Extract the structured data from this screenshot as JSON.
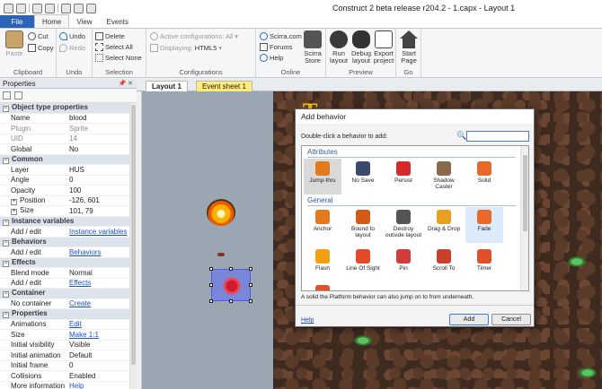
{
  "window": {
    "title": "Construct 2 beta release r204.2 - 1.capx - Layout 1"
  },
  "ribbon_tabs": [
    "File",
    "Home",
    "View",
    "Events"
  ],
  "ribbon": {
    "clipboard": {
      "paste": "Paste",
      "cut": "Cut",
      "copy": "Copy",
      "label": "Clipboard"
    },
    "undo": {
      "undo": "Undo",
      "redo": "Redo",
      "label": "Undo"
    },
    "selection": {
      "delete": "Delete",
      "select_all": "Select All",
      "select_none": "Select None",
      "label": "Selection"
    },
    "configurations": {
      "active": "Active configurations: All",
      "displaying": "Displaying:",
      "displaying_value": "HTML5",
      "label": "Configurations"
    },
    "online": {
      "scirra": "Scirra.com",
      "forums": "Forums",
      "help": "Help",
      "store": "Scirra Store",
      "label": "Online"
    },
    "preview": {
      "run": "Run layout",
      "debug": "Debug layout",
      "export": "Export project",
      "label": "Preview"
    },
    "go": {
      "start": "Start Page",
      "label": "Go"
    }
  },
  "properties_panel": {
    "title": "Properties",
    "rows": [
      {
        "type": "cat",
        "k": "Object type properties"
      },
      {
        "k": "Name",
        "v": "blood"
      },
      {
        "k": "Plugin",
        "v": "Sprite",
        "dim": true
      },
      {
        "k": "UID",
        "v": "14",
        "dim": true
      },
      {
        "k": "Global",
        "v": "No"
      },
      {
        "type": "cat",
        "k": "Common"
      },
      {
        "k": "Layer",
        "v": "HUS"
      },
      {
        "k": "Angle",
        "v": "0"
      },
      {
        "k": "Opacity",
        "v": "100"
      },
      {
        "k": "Position",
        "v": "-126, 601",
        "plus": true
      },
      {
        "k": "Size",
        "v": "101, 79",
        "plus": true
      },
      {
        "type": "cat",
        "k": "Instance variables"
      },
      {
        "k": "Add / edit",
        "v": "Instance variables",
        "link": true
      },
      {
        "type": "cat",
        "k": "Behaviors"
      },
      {
        "k": "Add / edit",
        "v": "Behaviors",
        "link": true
      },
      {
        "type": "cat",
        "k": "Effects"
      },
      {
        "k": "Blend mode",
        "v": "Normal"
      },
      {
        "k": "Add / edit",
        "v": "Effects",
        "link": true
      },
      {
        "type": "cat",
        "k": "Container"
      },
      {
        "k": "No container",
        "v": "Create",
        "link": true
      },
      {
        "type": "cat",
        "k": "Properties"
      },
      {
        "k": "Animations",
        "v": "Edit",
        "link": true
      },
      {
        "k": "Size",
        "v": "Make 1:1",
        "link": true
      },
      {
        "k": "Initial visibility",
        "v": "Visible"
      },
      {
        "k": "Initial animation",
        "v": "Default"
      },
      {
        "k": "Initial frame",
        "v": "0"
      },
      {
        "k": "Collisions",
        "v": "Enabled"
      },
      {
        "k": "More information",
        "v": "Help",
        "link": true
      }
    ]
  },
  "doc_tabs": {
    "layout": "Layout 1",
    "events": "Event sheet 1"
  },
  "canvas": {
    "gold_text": "T"
  },
  "dialog": {
    "title": "Add behavior",
    "prompt": "Double-click a behavior to add:",
    "search_value": "",
    "categories": [
      {
        "name": "Attributes",
        "items": [
          {
            "label": "Jump-thru",
            "icon": "jumpthru-icon",
            "color": "#e07a1c",
            "selected": true
          },
          {
            "label": "No Save",
            "icon": "nosave-icon",
            "color": "#3b4a6b"
          },
          {
            "label": "Persist",
            "icon": "persist-icon",
            "color": "#d62a2a"
          },
          {
            "label": "Shadow Caster",
            "icon": "shadow-caster-icon",
            "color": "#8a6a4a"
          },
          {
            "label": "Solid",
            "icon": "solid-icon",
            "color": "#e8672a"
          }
        ]
      },
      {
        "name": "General",
        "items": [
          {
            "label": "Anchor",
            "icon": "anchor-icon",
            "color": "#e07a1c"
          },
          {
            "label": "Bound to layout",
            "icon": "bound-icon",
            "color": "#d45a1a"
          },
          {
            "label": "Destroy outside layout",
            "icon": "destroy-icon",
            "color": "#555555"
          },
          {
            "label": "Drag & Drop",
            "icon": "drag-drop-icon",
            "color": "#e8a020"
          },
          {
            "label": "Fade",
            "icon": "fade-icon",
            "color": "#e86a2a",
            "hover": true
          },
          {
            "label": "Flash",
            "icon": "flash-icon",
            "color": "#f0a010"
          },
          {
            "label": "Line Of Sight",
            "icon": "line-of-sight-icon",
            "color": "#e24a2a"
          },
          {
            "label": "Pin",
            "icon": "pin-icon",
            "color": "#d43a3a"
          },
          {
            "label": "Scroll To",
            "icon": "scroll-to-icon",
            "color": "#c8402a"
          },
          {
            "label": "Timer",
            "icon": "timer-icon",
            "color": "#e0502a"
          }
        ]
      }
    ],
    "description": "A solid the Platform behavior can also jump on to from underneath.",
    "help": "Help",
    "add": "Add",
    "cancel": "Cancel"
  }
}
